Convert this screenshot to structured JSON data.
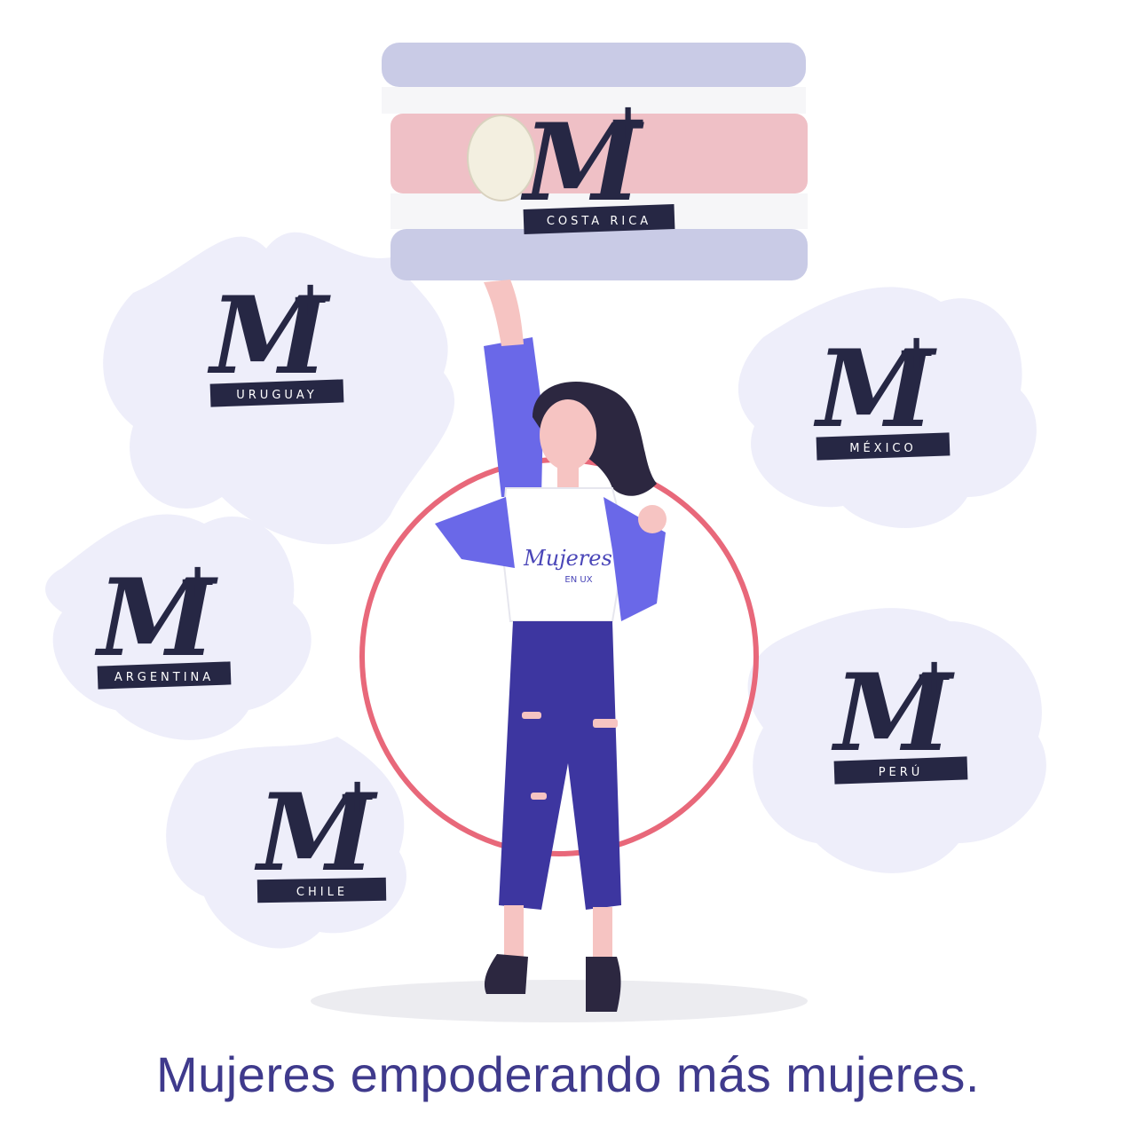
{
  "logos": {
    "letter": "M",
    "plus": "+",
    "costa_rica": "COSTA RICA",
    "uruguay": "URUGUAY",
    "mexico": "MÉXICO",
    "argentina": "ARGENTINA",
    "peru": "PERÚ",
    "chile": "CHILE"
  },
  "shirt": {
    "brand": "Mujeres",
    "sub": "EN UX"
  },
  "tagline": "Mujeres empoderando más mujeres.",
  "colors": {
    "splash": "#eeeefa",
    "ring": "#e8687a",
    "jacket": "#6a68e8",
    "jeans": "#3d36a0",
    "hair": "#2c2740",
    "skin": "#f6c4c2",
    "logo_ink": "#262744",
    "flag_blue": "#c9cbe6",
    "flag_red": "#efc0c6"
  }
}
